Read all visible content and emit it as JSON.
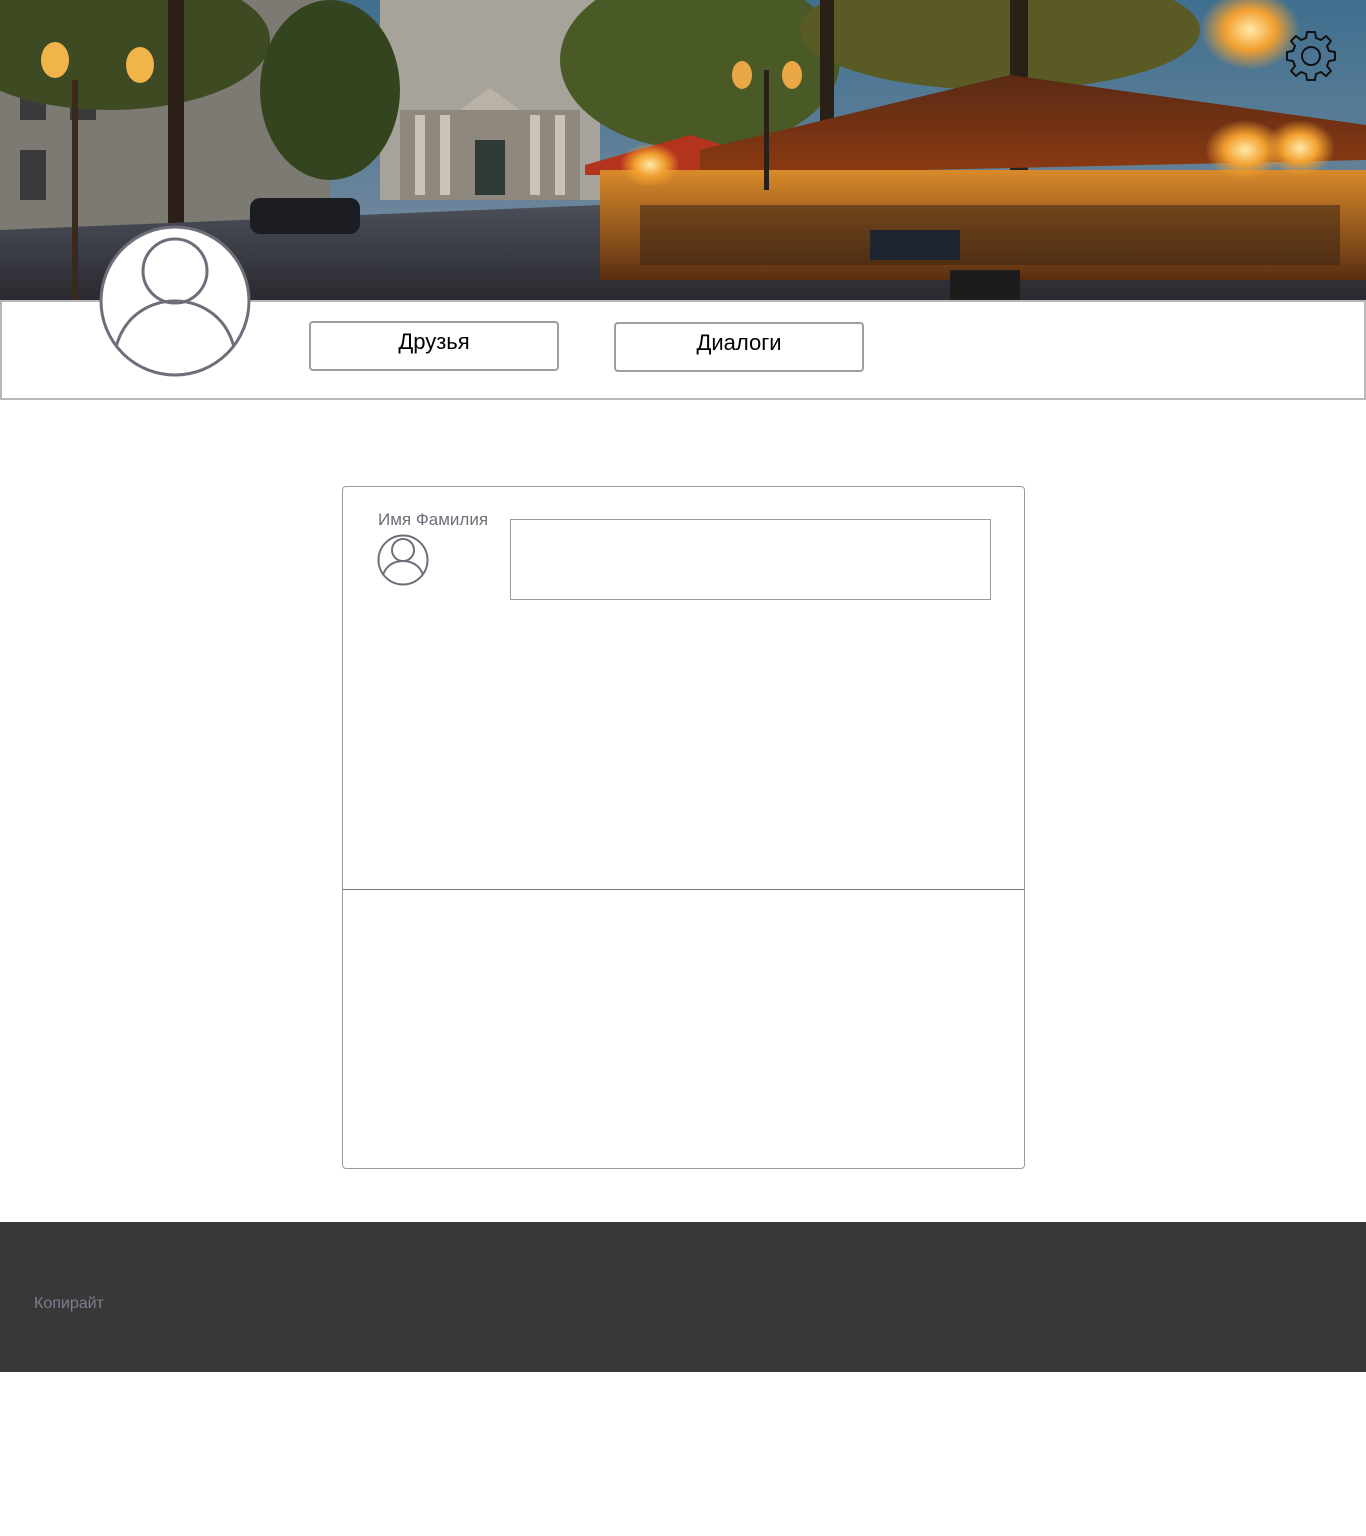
{
  "header": {
    "settings_icon": "gear-icon"
  },
  "profile": {
    "avatar_icon": "user-avatar-icon"
  },
  "nav": {
    "friends_label": "Друзья",
    "dialogs_label": "Диалоги"
  },
  "post": {
    "author_name": "Имя Фамилия",
    "input_value": "",
    "avatar_icon": "user-avatar-icon"
  },
  "footer": {
    "copyright": "Копирайт"
  },
  "colors": {
    "footer_bg": "#383838",
    "avatar_stroke": "#6d6e7a",
    "border": "#9b9b9b"
  }
}
